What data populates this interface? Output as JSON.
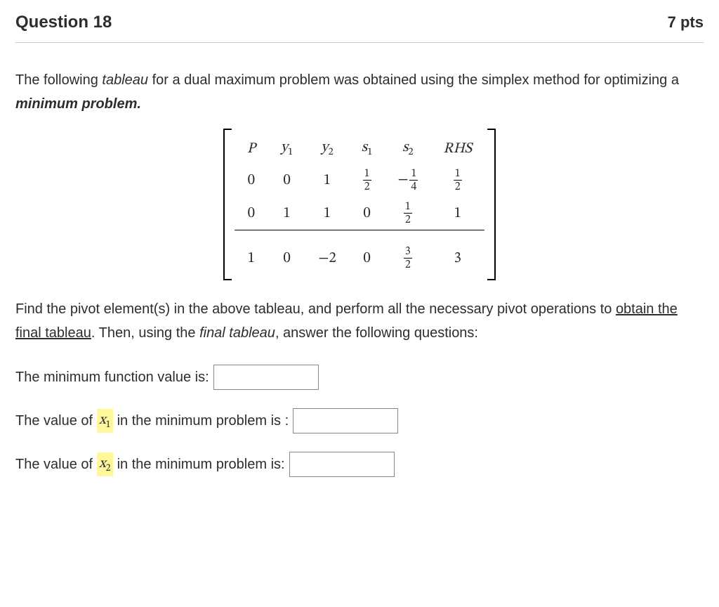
{
  "header": {
    "title": "Question 18",
    "points": "7 pts"
  },
  "prompt": {
    "part1": "The following ",
    "tableau_word": "tableau",
    "part2": " for a dual maximum problem was obtained using the simplex method for optimizing a ",
    "minprob_word": "minimum problem.",
    "part3": ""
  },
  "tableau": {
    "headers": {
      "P": "P",
      "y1": "y",
      "y1sub": "1",
      "y2": "y",
      "y2sub": "2",
      "s1": "s",
      "s1sub": "1",
      "s2": "s",
      "s2sub": "2",
      "RHS": "RHS"
    },
    "row1": {
      "P": "0",
      "y1": "0",
      "y2": "1",
      "s1_num": "1",
      "s1_den": "2",
      "s2_neg": "−",
      "s2_num": "1",
      "s2_den": "4",
      "rhs_num": "1",
      "rhs_den": "2"
    },
    "row2": {
      "P": "0",
      "y1": "1",
      "y2": "1",
      "s1": "0",
      "s2_num": "1",
      "s2_den": "2",
      "rhs": "1"
    },
    "row3": {
      "P": "1",
      "y1": "0",
      "y2": "−2",
      "s1": "0",
      "s2_num": "3",
      "s2_den": "2",
      "rhs": "3"
    }
  },
  "instructions": {
    "part1": "Find the pivot element(s) in the above tableau, and perform all the necessary pivot operations to ",
    "underlined": "obtain the final tableau",
    "part2": ". Then, using the ",
    "final_tab": "final tableau",
    "part3": ", answer the following questions:"
  },
  "answers": {
    "q1_label": "The minimum function value is:",
    "q2_pre": "The value of ",
    "q2_var": "x",
    "q2_sub": "1",
    "q2_post": " in the minimum problem is :",
    "q3_pre": "The value of ",
    "q3_var": "x",
    "q3_sub": "2",
    "q3_post": "  in the minimum problem is:"
  },
  "chart_data": {
    "type": "table",
    "columns": [
      "P",
      "y1",
      "y2",
      "s1",
      "s2",
      "RHS"
    ],
    "rows": [
      [
        0,
        0,
        1,
        0.5,
        -0.25,
        0.5
      ],
      [
        0,
        1,
        1,
        0,
        0.5,
        1
      ],
      [
        1,
        0,
        -2,
        0,
        1.5,
        3
      ]
    ],
    "note": "Horizontal rule between row index 1 and 2 (objective row separated)."
  }
}
